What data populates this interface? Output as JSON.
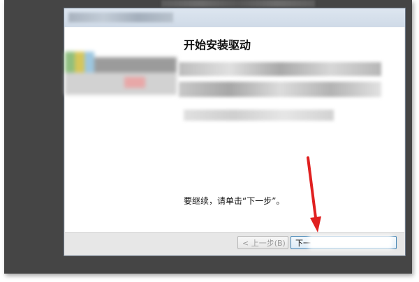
{
  "dialog": {
    "heading": "开始安装驱动",
    "instruction": "要继续，请单击“下一步”。"
  },
  "buttons": {
    "back_label": "< 上一步(B)",
    "next_label": "下一"
  },
  "annotation": {
    "arrow_color": "#e02020"
  },
  "colors": {
    "backdrop": "#454545",
    "dialog_border": "#6f7c8c",
    "next_button_border": "#3c7fb1"
  }
}
